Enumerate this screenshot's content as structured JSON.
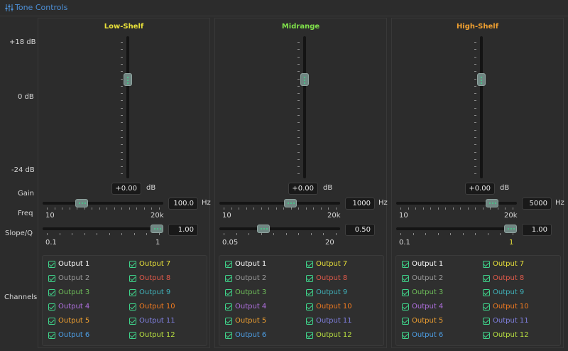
{
  "window": {
    "title": "Tone Controls",
    "title_icon": "sliders-icon"
  },
  "row_labels": {
    "db_top": "+18 dB",
    "db_mid": "0 dB",
    "db_bottom": "-24 dB",
    "gain": "Gain",
    "freq": "Freq",
    "slope": "Slope/Q",
    "channels": "Channels"
  },
  "bands": [
    {
      "name": "Low-Shelf",
      "color": "#e8e03a",
      "gain_value": "+0.00",
      "gain_unit": "dB",
      "gain_level_db": 0,
      "freq_value": "100.0",
      "freq_unit": "Hz",
      "freq_min": "10",
      "freq_max": "20k",
      "freq_pos": 0.3,
      "slope_value": "1.00",
      "slope_min": "0.1",
      "slope_max": "1",
      "slope_pos": 1.0
    },
    {
      "name": "Midrange",
      "color": "#7fe04a",
      "gain_value": "+0.00",
      "gain_unit": "dB",
      "gain_level_db": 0,
      "freq_value": "1000",
      "freq_unit": "Hz",
      "freq_min": "10",
      "freq_max": "20k",
      "freq_pos": 0.6,
      "slope_value": "0.50",
      "slope_min": "0.05",
      "slope_max": "20",
      "slope_pos": 0.35
    },
    {
      "name": "High-Shelf",
      "color": "#f0a030",
      "gain_value": "+0.00",
      "gain_unit": "dB",
      "gain_level_db": 0,
      "freq_value": "5000",
      "freq_unit": "Hz",
      "freq_min": "10",
      "freq_max": "20k",
      "freq_pos": 0.83,
      "slope_value": "1.00",
      "slope_min": "0.1",
      "slope_max": "1",
      "slope_pos": 1.0
    }
  ],
  "outputs": [
    {
      "label": "Output 1",
      "color": "#ffffff",
      "checked": true
    },
    {
      "label": "Output 2",
      "color": "#9a9a9a",
      "checked": true
    },
    {
      "label": "Output 3",
      "color": "#6fbf5a",
      "checked": true
    },
    {
      "label": "Output 4",
      "color": "#b070e0",
      "checked": true
    },
    {
      "label": "Output 5",
      "color": "#f0a030",
      "checked": true
    },
    {
      "label": "Output 6",
      "color": "#4d9fe6",
      "checked": true
    },
    {
      "label": "Output 7",
      "color": "#e8e03a",
      "checked": true
    },
    {
      "label": "Output 8",
      "color": "#e05a4a",
      "checked": true
    },
    {
      "label": "Output 9",
      "color": "#40b0b8",
      "checked": true
    },
    {
      "label": "Output 10",
      "color": "#f07a20",
      "checked": true
    },
    {
      "label": "Output 11",
      "color": "#8080e0",
      "checked": true
    },
    {
      "label": "Output 12",
      "color": "#b8e040",
      "checked": true
    }
  ]
}
